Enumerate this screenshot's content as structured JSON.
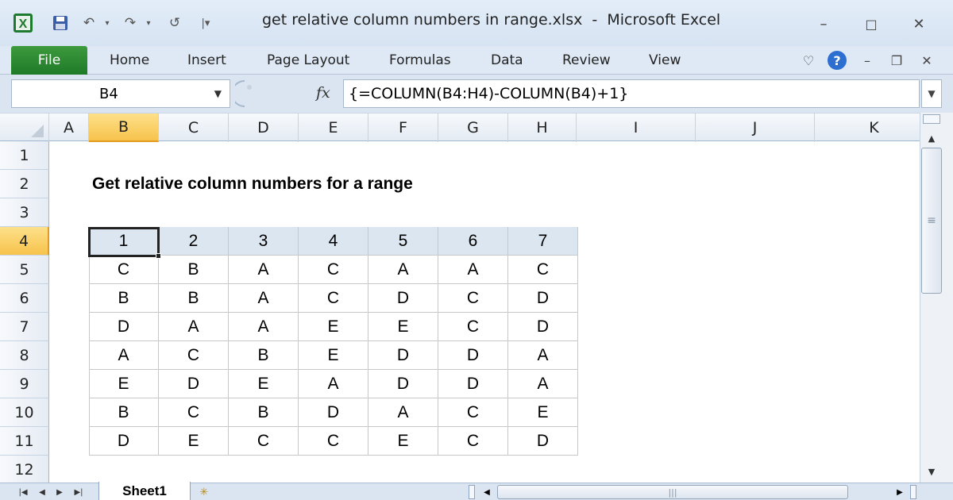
{
  "window": {
    "title": "get relative column numbers in range.xlsx  -  Microsoft Excel",
    "app_icon": "excel-x-icon",
    "controls": {
      "minimize": "–",
      "restore": "□",
      "close": "✕"
    }
  },
  "quick_access": {
    "save": "save-icon",
    "undo": "undo-icon",
    "redo": "redo-icon",
    "refresh": "refresh-icon",
    "customize": "customize-icon"
  },
  "ribbon": {
    "file_label": "File",
    "tabs": [
      "Home",
      "Insert",
      "Page Layout",
      "Formulas",
      "Data",
      "Review",
      "View"
    ],
    "help_glyph": "?"
  },
  "formula_bar": {
    "name_box": "B4",
    "fx_label": "fx",
    "formula": "{=COLUMN(B4:H4)-COLUMN(B4)+1}"
  },
  "grid": {
    "columns": [
      "A",
      "B",
      "C",
      "D",
      "E",
      "F",
      "G",
      "H",
      "I",
      "J",
      "K"
    ],
    "active_column": "B",
    "rows": [
      "1",
      "2",
      "3",
      "4",
      "5",
      "6",
      "7",
      "8",
      "9",
      "10",
      "11",
      "12"
    ],
    "active_row": "4",
    "title": "Get relative column numbers for a range",
    "header_values": [
      "1",
      "2",
      "3",
      "4",
      "5",
      "6",
      "7"
    ],
    "table": [
      [
        "C",
        "B",
        "A",
        "C",
        "A",
        "A",
        "C"
      ],
      [
        "B",
        "B",
        "A",
        "C",
        "D",
        "C",
        "D"
      ],
      [
        "D",
        "A",
        "A",
        "E",
        "E",
        "C",
        "D"
      ],
      [
        "A",
        "C",
        "B",
        "E",
        "D",
        "D",
        "A"
      ],
      [
        "E",
        "D",
        "E",
        "A",
        "D",
        "D",
        "A"
      ],
      [
        "B",
        "C",
        "B",
        "D",
        "A",
        "C",
        "E"
      ],
      [
        "D",
        "E",
        "C",
        "C",
        "E",
        "C",
        "D"
      ]
    ]
  },
  "sheets": {
    "active": "Sheet1"
  },
  "colors": {
    "header_fill": "#dce6f1",
    "file_tab": "#2a8a30",
    "active_header": "#f7c34c"
  }
}
